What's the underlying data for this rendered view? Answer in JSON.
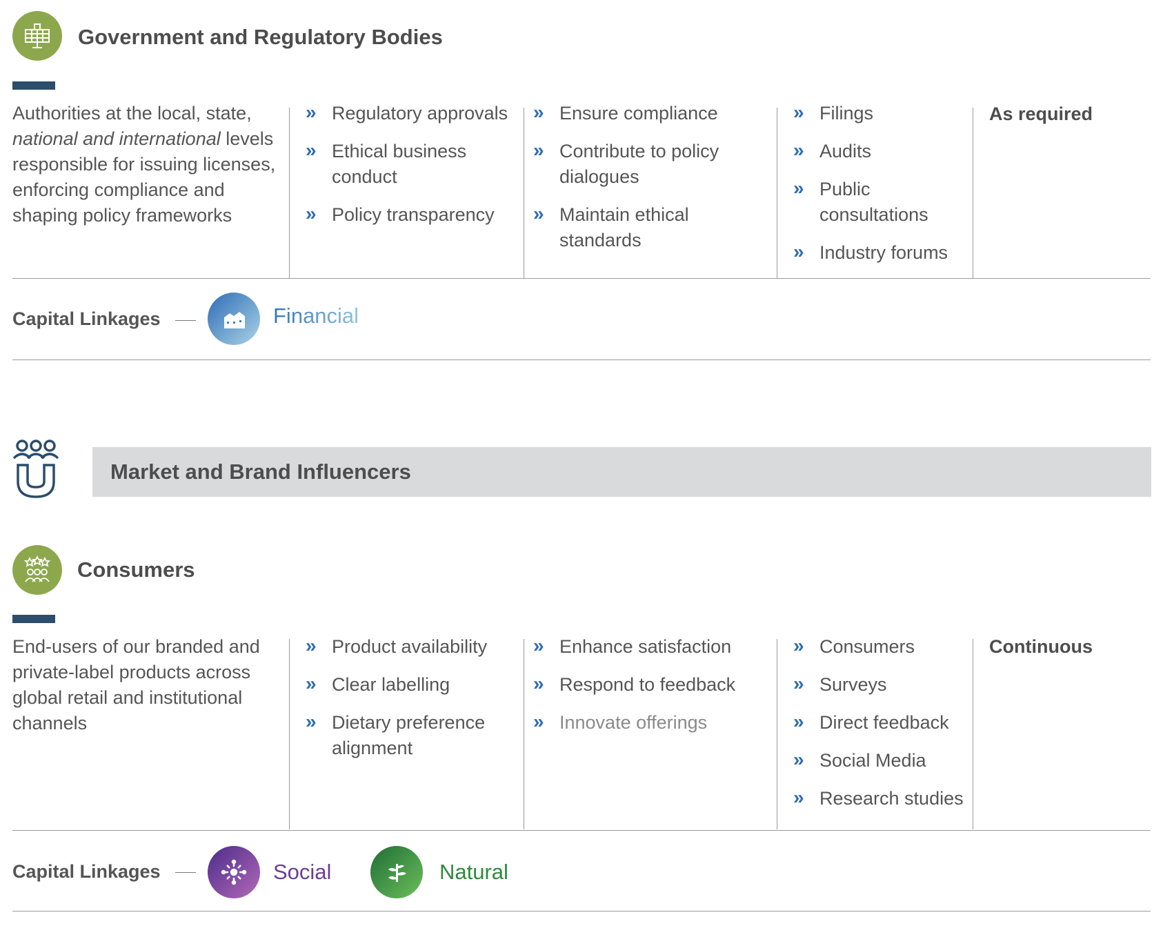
{
  "government": {
    "icon": "building-icon",
    "title": "Government and Regulatory Bodies",
    "description": {
      "part1": "Authorities at the local, state,",
      "italic": "national and international",
      "part2": "levels responsible for issuing licenses, enforcing compliance and shaping policy frameworks"
    },
    "col1": [
      "Regulatory approvals",
      "Ethical business conduct",
      "Policy transparency"
    ],
    "col2": [
      "Ensure compliance",
      "Contribute to policy dialogues",
      "Maintain ethical standards"
    ],
    "col3": [
      "Filings",
      "Audits",
      "Public consultations",
      "Industry forums"
    ],
    "frequency": "As required",
    "capital_label": "Capital Linkages",
    "capitals": [
      {
        "name": "Financial",
        "icon": "financial-capital-icon",
        "color": "#3e7fc0"
      }
    ]
  },
  "banner": {
    "icon": "magnet-people-icon",
    "title": "Market and Brand Influencers"
  },
  "consumers": {
    "icon": "consumers-icon",
    "title": "Consumers",
    "description": "End-users of our branded and private-label products across global retail and institutional channels",
    "col1": [
      "Product availability",
      "Clear labelling",
      "Dietary preference alignment"
    ],
    "col2": [
      "Enhance satisfaction",
      "Respond to feedback",
      "Innovate offerings"
    ],
    "col3": [
      "Consumers",
      "Surveys",
      "Direct feedback",
      "Social Media",
      "Research studies"
    ],
    "frequency": "Continuous",
    "capital_label": "Capital Linkages",
    "capitals": [
      {
        "name": "Social",
        "icon": "social-capital-icon",
        "color": "#6b3d94"
      },
      {
        "name": "Natural",
        "icon": "natural-capital-icon",
        "color": "#2e8a3c"
      }
    ]
  },
  "chevron": "»",
  "colors": {
    "accent_bar": "#2c4d6b",
    "icon_green": "#8da84c",
    "chevron_blue": "#2f6db3",
    "banner_gray": "#d9dadb"
  }
}
